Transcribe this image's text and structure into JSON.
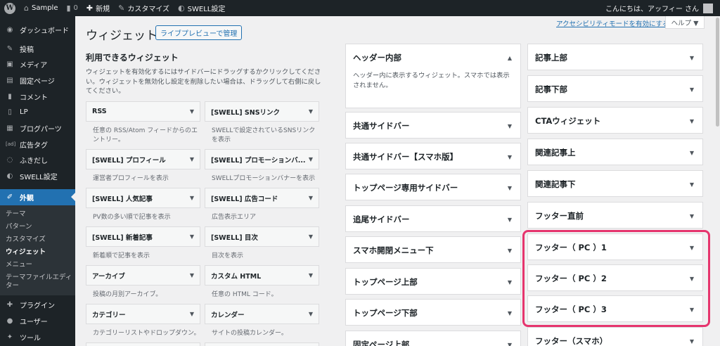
{
  "adminbar": {
    "wp_logo": "W",
    "site_name": "Sample",
    "comments_count": "0",
    "new_label": "新規",
    "customize_label": "カスタマイズ",
    "swell_label": "SWELL設定",
    "greeting": "こんにちは、アッフィー さん"
  },
  "sidebar": {
    "items_top": [
      {
        "label": "ダッシュボード",
        "icon": "◉"
      },
      {
        "label": "投稿",
        "icon": "✎"
      },
      {
        "label": "メディア",
        "icon": "▣"
      },
      {
        "label": "固定ページ",
        "icon": "▤"
      },
      {
        "label": "コメント",
        "icon": "▮"
      },
      {
        "label": "LP",
        "icon": "▯"
      },
      {
        "label": "ブログパーツ",
        "icon": "▦"
      },
      {
        "label": "広告タグ",
        "icon": "[ad]"
      },
      {
        "label": "ふきだし",
        "icon": "◌"
      },
      {
        "label": "SWELL設定",
        "icon": "◐"
      }
    ],
    "current": {
      "label": "外観",
      "icon": "✐"
    },
    "submenu": [
      "テーマ",
      "パターン",
      "カスタマイズ",
      "ウィジェット",
      "メニュー",
      "テーマファイルエディター"
    ],
    "items_bottom": [
      {
        "label": "プラグイン",
        "icon": "✚"
      },
      {
        "label": "ユーザー",
        "icon": "●"
      },
      {
        "label": "ツール",
        "icon": "✦"
      }
    ]
  },
  "header": {
    "title": "ウィジェット",
    "live_preview_button": "ライブプレビューで管理",
    "accessibility_link": "アクセシビリティモードを有効にする",
    "help_tab": "ヘルプ ▼"
  },
  "available": {
    "title": "利用できるウィジェット",
    "description": "ウィジェットを有効化するにはサイドバーにドラッグするかクリックしてください。ウィジェットを無効化し設定を削除したい場合は、ドラッグして右側に戻してください。",
    "widgets": [
      {
        "title": "RSS",
        "desc": "任意の RSS/Atom フィードからのエントリー。"
      },
      {
        "title": "[SWELL] SNSリンク",
        "desc": "SWELLで設定されているSNSリンクを表示"
      },
      {
        "title": "[SWELL] プロフィール",
        "desc": "運営者プロフィールを表示"
      },
      {
        "title": "[SWELL] プロモーションバ...",
        "desc": "SWELLプロモーションバナーを表示"
      },
      {
        "title": "[SWELL] 人気記事",
        "desc": "PV数の多い順で記事を表示"
      },
      {
        "title": "[SWELL] 広告コード",
        "desc": "広告表示エリア"
      },
      {
        "title": "[SWELL] 新着記事",
        "desc": "新着順で記事を表示"
      },
      {
        "title": "[SWELL] 目次",
        "desc": "目次を表示"
      },
      {
        "title": "アーカイブ",
        "desc": "投稿の月別アーカイブ。"
      },
      {
        "title": "カスタム HTML",
        "desc": "任意の HTML コード。"
      },
      {
        "title": "カテゴリー",
        "desc": "カテゴリーリストやドロップダウン。"
      },
      {
        "title": "カレンダー",
        "desc": "サイトの投稿カレンダー。"
      }
    ]
  },
  "areas_middle": [
    {
      "title": "ヘッダー内部",
      "desc": "ヘッダー内に表示するウィジェット。スマホでは表示されません。",
      "open": true
    },
    {
      "title": "共通サイドバー"
    },
    {
      "title": "共通サイドバー【スマホ版】"
    },
    {
      "title": "トップページ専用サイドバー"
    },
    {
      "title": "追尾サイドバー"
    },
    {
      "title": "スマホ開閉メニュー下"
    },
    {
      "title": "トップページ上部"
    },
    {
      "title": "トップページ下部"
    },
    {
      "title": "固定ページ上部"
    }
  ],
  "areas_right": [
    {
      "title": "記事上部"
    },
    {
      "title": "記事下部"
    },
    {
      "title": "CTAウィジェット"
    },
    {
      "title": "関連記事上"
    },
    {
      "title": "関連記事下"
    },
    {
      "title": "フッター直前"
    },
    {
      "title": "フッター（ PC ）1"
    },
    {
      "title": "フッター（ PC ）2"
    },
    {
      "title": "フッター（ PC ）3"
    },
    {
      "title": "フッター（スマホ）"
    }
  ],
  "icons": {
    "arrow_down": "▼",
    "arrow_up": "▲"
  },
  "colors": {
    "highlight": "#e6356e",
    "accent": "#2271b1",
    "adminbar": "#1d2327"
  }
}
